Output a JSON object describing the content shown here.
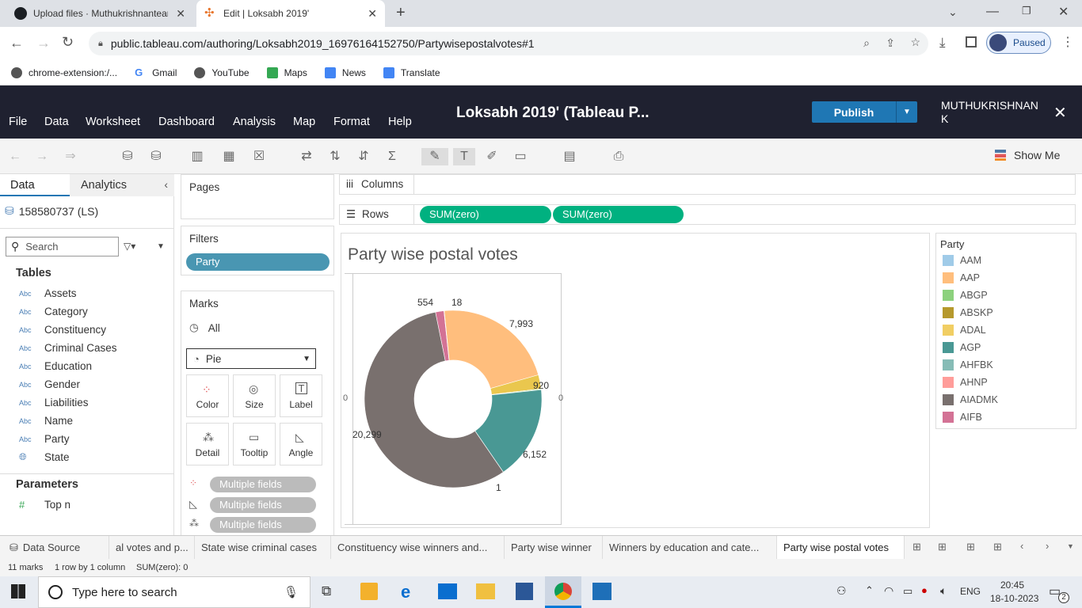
{
  "browser": {
    "tabs": [
      {
        "label": "Upload files · Muthukrishnantear",
        "active": false
      },
      {
        "label": "Edit | Loksabh 2019'",
        "active": true
      }
    ],
    "url": "public.tableau.com/authoring/Loksabh2019_16976164152750/Partywisepostalvotes#1",
    "profile_label": "Paused",
    "bookmarks": [
      "chrome-extension:/...",
      "Gmail",
      "YouTube",
      "Maps",
      "News",
      "Translate"
    ]
  },
  "tableau": {
    "menu": [
      "File",
      "Data",
      "Worksheet",
      "Dashboard",
      "Analysis",
      "Map",
      "Format",
      "Help"
    ],
    "workbook_title": "Loksabh 2019' (Tableau P...",
    "publish_label": "Publish",
    "user_name": "MUTHUKRISHNAN K",
    "show_me_label": "Show Me"
  },
  "datapane": {
    "tabs": [
      "Data",
      "Analytics"
    ],
    "datasource": "158580737 (LS)",
    "search_placeholder": "Search",
    "tables_heading": "Tables",
    "fields": [
      "Assets",
      "Category",
      "Constituency",
      "Criminal Cases",
      "Education",
      "Gender",
      "Liabilities",
      "Name",
      "Party",
      "State"
    ],
    "field_type_label": "Abc",
    "parameters_heading": "Parameters",
    "parameters": [
      "Top n"
    ]
  },
  "shelves": {
    "pages_label": "Pages",
    "filters_label": "Filters",
    "filter_pill": "Party",
    "marks_label": "Marks",
    "marks_all": "All",
    "mark_type": "Pie",
    "mark_buttons": [
      "Color",
      "Size",
      "Label",
      "Detail",
      "Tooltip",
      "Angle"
    ],
    "multi_pills": [
      "Multiple fields",
      "Multiple fields",
      "Multiple fields"
    ],
    "columns_label": "Columns",
    "rows_label": "Rows",
    "row_pills": [
      "SUM(zero)",
      "SUM(zero)"
    ]
  },
  "view": {
    "title": "Party wise postal votes",
    "axis_zero_left": "0",
    "axis_zero_right": "0"
  },
  "chart_data": {
    "type": "pie",
    "title": "Party wise postal votes",
    "donut": true,
    "slices": [
      {
        "label": "7,993",
        "value": 7993,
        "color": "#ffbe7d"
      },
      {
        "label": "920",
        "value": 920,
        "color": "#eac74e"
      },
      {
        "label": "",
        "value": 60,
        "color": "#8cd17d"
      },
      {
        "label": "6,152",
        "value": 6152,
        "color": "#499894"
      },
      {
        "label": "1",
        "value": 1,
        "color": "#86bcb6"
      },
      {
        "label": "20,299",
        "value": 20299,
        "color": "#79706e"
      },
      {
        "label": "554",
        "value": 554,
        "color": "#d37295"
      },
      {
        "label": "18",
        "value": 18,
        "color": "#ff9d9a"
      }
    ]
  },
  "legend": {
    "title": "Party",
    "items": [
      {
        "label": "AAM",
        "color": "#a0cbe8"
      },
      {
        "label": "AAP",
        "color": "#ffbe7d"
      },
      {
        "label": "ABGP",
        "color": "#8cd17d"
      },
      {
        "label": "ABSKP",
        "color": "#b6992d"
      },
      {
        "label": "ADAL",
        "color": "#f1ce63"
      },
      {
        "label": "AGP",
        "color": "#499894"
      },
      {
        "label": "AHFBK",
        "color": "#86bcb6"
      },
      {
        "label": "AHNP",
        "color": "#ff9d9a"
      },
      {
        "label": "AIADMK",
        "color": "#79706e"
      },
      {
        "label": "AIFB",
        "color": "#d37295"
      }
    ]
  },
  "sheet_tabs": {
    "datasource": "Data Source",
    "tabs": [
      "al votes and p...",
      "State wise criminal cases",
      "Constituency wise winners and...",
      "Party wise winner",
      "Winners by education and cate...",
      "Party wise postal votes"
    ],
    "active_index": 5
  },
  "status": {
    "marks": "11 marks",
    "dims": "1 row by 1 column",
    "sum": "SUM(zero): 0"
  },
  "taskbar": {
    "search_placeholder": "Type here to search",
    "lang": "ENG",
    "time": "20:45",
    "date": "18-10-2023",
    "notif_count": "2"
  }
}
